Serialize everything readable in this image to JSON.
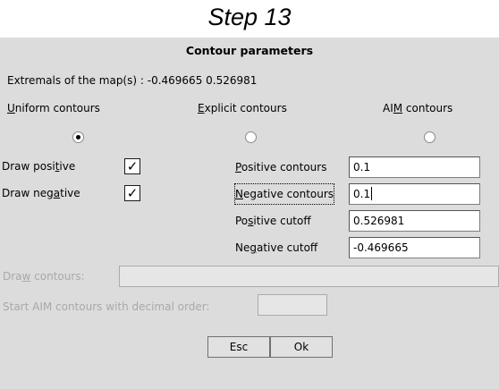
{
  "step_title": "Step 13",
  "dialog": {
    "title": "Contour parameters",
    "extremals_label": "Extremals of the map(s) :",
    "extremals_values": "-0.469665 0.526981",
    "modes": {
      "uniform": {
        "pre": "",
        "u": "U",
        "post": "niform contours",
        "selected": true
      },
      "explicit": {
        "pre": "",
        "u": "E",
        "post": "xplicit contours",
        "selected": false
      },
      "aim": {
        "pre": "AI",
        "u": "M",
        "post": " contours",
        "selected": false
      }
    },
    "draw_positive": {
      "pre": "Draw posi",
      "u": "t",
      "post": "ive",
      "checked": true,
      "mark": "✓"
    },
    "draw_negative": {
      "pre": "Draw neg",
      "u": "a",
      "post": "tive",
      "checked": true,
      "mark": "✓"
    },
    "fields": {
      "positive_contours": {
        "pre": "",
        "u": "P",
        "post": "ositive contours",
        "value": "0.1"
      },
      "negative_contours": {
        "pre": "",
        "u": "N",
        "post": "egative contours",
        "value": "0.1"
      },
      "positive_cutoff": {
        "pre": "Po",
        "u": "s",
        "post": "itive cutoff",
        "value": "0.526981"
      },
      "negative_cutoff": {
        "pre": "Ne",
        "u": "g",
        "post": "ative cutoff",
        "value": "-0.469665"
      }
    },
    "draw_contours": {
      "pre": "Dra",
      "u": "w",
      "post": " contours:",
      "value": ""
    },
    "start_aim": {
      "label": "Start AIM contours with decimal order:",
      "value": ""
    },
    "buttons": {
      "esc": "Esc",
      "ok": "Ok"
    }
  }
}
